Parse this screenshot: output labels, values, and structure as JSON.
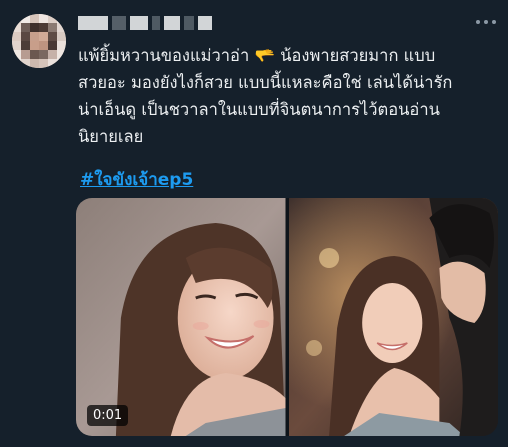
{
  "tweet": {
    "avatar_icon": "blurred-avatar-icon",
    "text": "แพ้ยิ้มหวานของแม่วาอ่า 🫳 น้องพายสวยมาก แบบ\nสวยอะ มองยังไงก็สวย แบบนี้แหละคือใช่ เล่นได้น่ารัก\nน่าเอ็นดู เป็นชวาลาในแบบที่จินตนาการไว้ตอนอ่าน\nนิยายเลย",
    "hashtag": "#ใจขังเจ้าep5",
    "more_icon": "more-options-icon"
  },
  "media": {
    "video_time": "0:01",
    "frame_left_icon": "video-frame-smiling-woman",
    "frame_right_icon": "video-frame-couple"
  },
  "colors": {
    "background": "#15202b",
    "text": "#e7e9ea",
    "link": "#1d9bf0"
  }
}
